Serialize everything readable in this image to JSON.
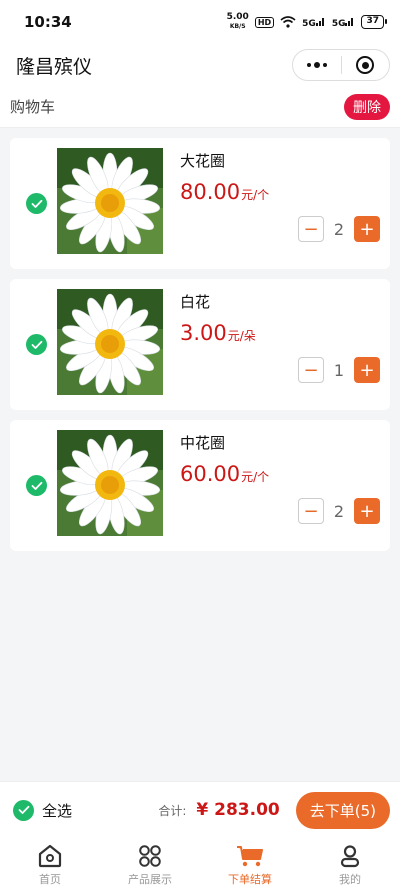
{
  "status_bar": {
    "time": "10:34",
    "net_speed_value": "5.00",
    "net_speed_unit": "KB/S",
    "hd": "HD",
    "signal_1": "5G",
    "signal_2": "5G",
    "battery": "37"
  },
  "nav": {
    "title": "隆昌殡仪",
    "icons": [
      "more-dots-icon",
      "close-target-icon"
    ]
  },
  "cart": {
    "title": "购物车",
    "delete_label": "删除"
  },
  "items": [
    {
      "name": "大花圈",
      "price": "80.00",
      "unit": "元/个",
      "quantity": "2",
      "checked": true,
      "image": "daisy-flower-image"
    },
    {
      "name": "白花",
      "price": "3.00",
      "unit": "元/朵",
      "quantity": "1",
      "checked": true,
      "image": "daisy-flower-image"
    },
    {
      "name": "中花圈",
      "price": "60.00",
      "unit": "元/个",
      "quantity": "2",
      "checked": true,
      "image": "daisy-flower-image"
    }
  ],
  "stepper": {
    "minus": "−",
    "plus": "+"
  },
  "checkout": {
    "select_all_label": "全选",
    "total_label": "合计:",
    "total_value": "¥ 283.00",
    "order_button": "去下单(5)"
  },
  "tabs": [
    {
      "label": "首页",
      "icon": "home-icon",
      "active": false
    },
    {
      "label": "产品展示",
      "icon": "grid-icon",
      "active": false
    },
    {
      "label": "下单结算",
      "icon": "cart-icon",
      "active": true
    },
    {
      "label": "我的",
      "icon": "user-icon",
      "active": false
    }
  ],
  "colors": {
    "accent": "#ea6a2a",
    "price_red": "#cc1717",
    "delete_red": "#e3173f",
    "check_green": "#1fb96a"
  }
}
